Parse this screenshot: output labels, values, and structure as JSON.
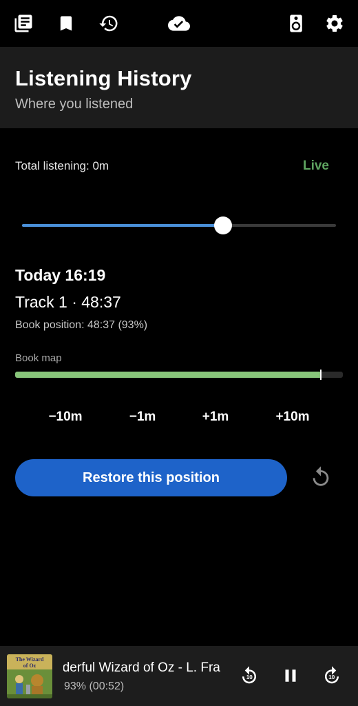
{
  "topbar": {
    "icons": [
      "library-icon",
      "bookmark-icon",
      "history-icon",
      "cloud-done-icon",
      "speaker-icon",
      "settings-icon"
    ]
  },
  "header": {
    "title": "Listening History",
    "subtitle": "Where you listened"
  },
  "summary": {
    "total_label": "Total listening: 0m",
    "live_label": "Live",
    "live_color": "#5fa561"
  },
  "timeline_slider": {
    "value_fraction": 0.64,
    "accent_color": "#4a90d9"
  },
  "entry": {
    "time": "Today 16:19",
    "track": "Track 1 · 48:37",
    "book_position": "Book position: 48:37 (93%)"
  },
  "book_map": {
    "label": "Book map",
    "progress_fraction": 0.93,
    "color": "#88c57a"
  },
  "jumps": [
    "−10m",
    "−1m",
    "+1m",
    "+10m"
  ],
  "restore": {
    "label": "Restore this position",
    "color": "#1e63c9"
  },
  "mini_player": {
    "title": "The Wonderful Wizard of Oz  -  L. Frank Baum",
    "subtitle": "93% (00:52)",
    "cover_alt": "The Wizard of Oz",
    "rewind_label": "10",
    "forward_label": "10"
  }
}
